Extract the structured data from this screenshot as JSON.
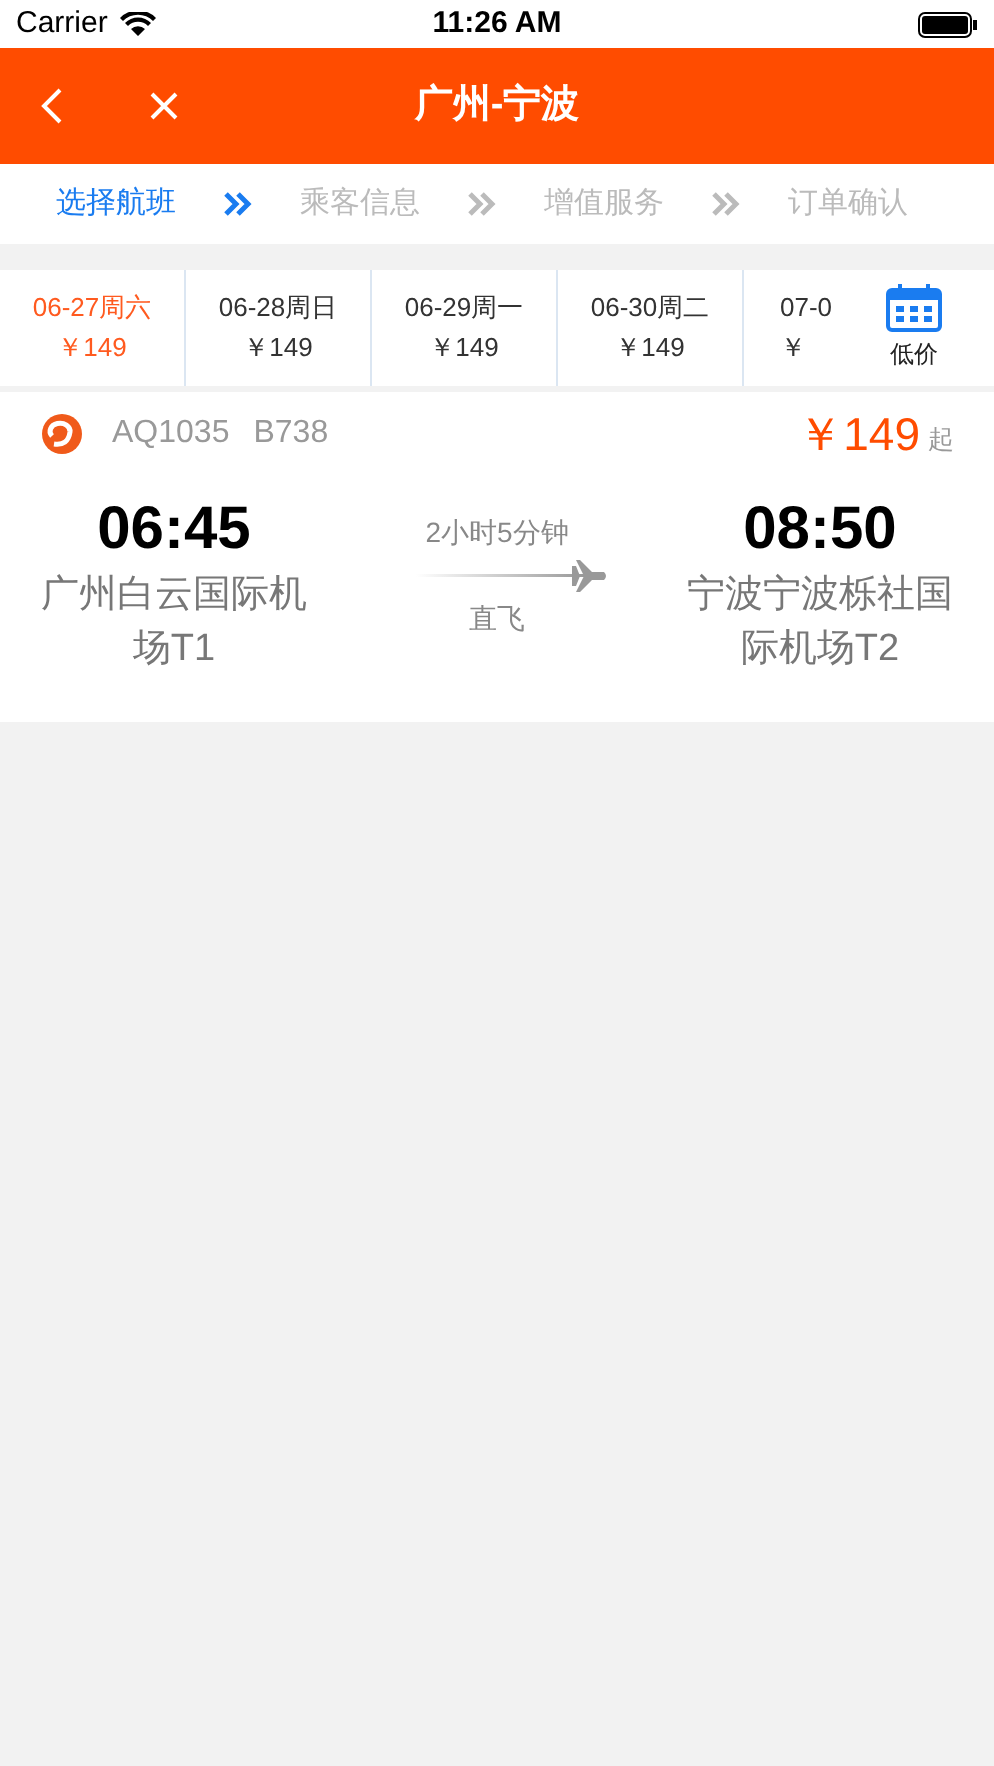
{
  "status_bar": {
    "carrier": "Carrier",
    "time": "11:26 AM"
  },
  "header": {
    "title": "广州-宁波"
  },
  "steps": [
    {
      "label": "选择航班",
      "selected": true
    },
    {
      "label": "乘客信息",
      "selected": false
    },
    {
      "label": "增值服务",
      "selected": false
    },
    {
      "label": "订单确认",
      "selected": false
    }
  ],
  "dates": [
    {
      "date": "06-27周六",
      "price": "￥149",
      "selected": true
    },
    {
      "date": "06-28周日",
      "price": "￥149",
      "selected": false
    },
    {
      "date": "06-29周一",
      "price": "￥149",
      "selected": false
    },
    {
      "date": "06-30周二",
      "price": "￥149",
      "selected": false
    },
    {
      "date": "07-0",
      "price": "￥",
      "selected": false
    }
  ],
  "calendar_button": {
    "label": "低价"
  },
  "flight": {
    "number": "AQ1035",
    "aircraft": "B738",
    "price": "￥149",
    "price_suffix": "起",
    "departure_time": "06:45",
    "departure_airport": "广州白云国际机场T1",
    "duration": "2小时5分钟",
    "stop_type": "直飞",
    "arrival_time": "08:50",
    "arrival_airport": "宁波宁波栎社国际机场T2"
  }
}
